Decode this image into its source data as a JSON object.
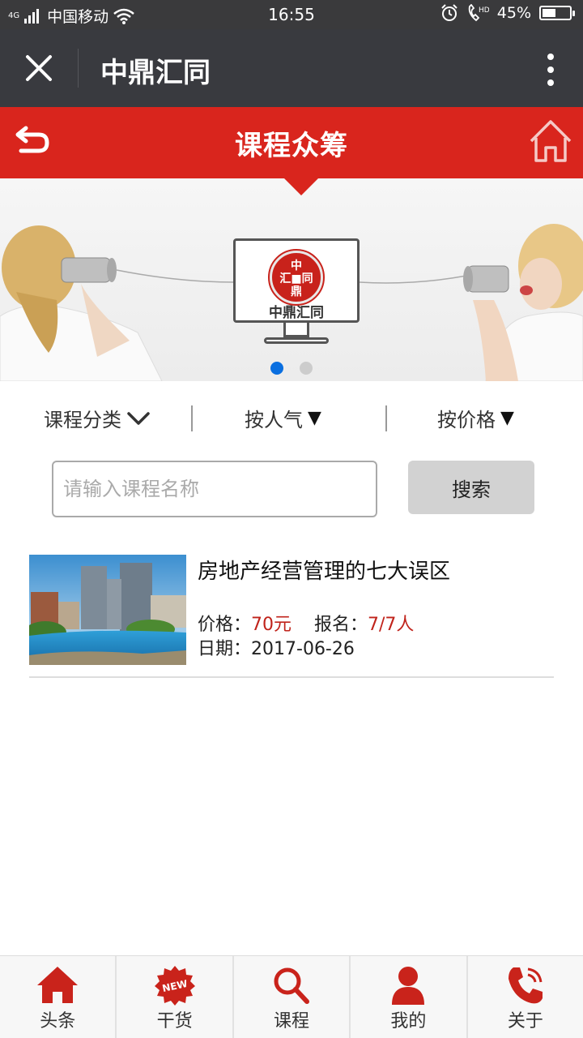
{
  "status_bar": {
    "network": "4G",
    "carrier": "中国移动",
    "time": "16:55",
    "battery_text": "45%",
    "battery_level": 0.45
  },
  "titlebar": {
    "title": "中鼎汇同"
  },
  "header": {
    "title": "课程众筹",
    "accent_color": "#d9251d"
  },
  "banner": {
    "seal_text": [
      "中",
      "汇",
      "同",
      "鼎"
    ],
    "brand": "中鼎汇同",
    "slides": 2,
    "active_slide": 1
  },
  "filters": [
    {
      "label": "课程分类"
    },
    {
      "label": "按人气"
    },
    {
      "label": "按价格"
    }
  ],
  "search": {
    "placeholder": "请输入课程名称",
    "button_label": "搜索"
  },
  "courses": [
    {
      "title": "房地产经营管理的七大误区",
      "price_label": "价格：",
      "price": "70元",
      "enroll_label": "报名：",
      "enrolled": "7/7人",
      "date_label": "日期：",
      "date": "2017-06-26"
    }
  ],
  "tabs": [
    {
      "label": "头条",
      "icon": "house-icon"
    },
    {
      "label": "干货",
      "icon": "new-badge-icon",
      "badge": "NEW"
    },
    {
      "label": "课程",
      "icon": "search-icon"
    },
    {
      "label": "我的",
      "icon": "user-icon"
    },
    {
      "label": "关于",
      "icon": "phone-icon"
    }
  ]
}
